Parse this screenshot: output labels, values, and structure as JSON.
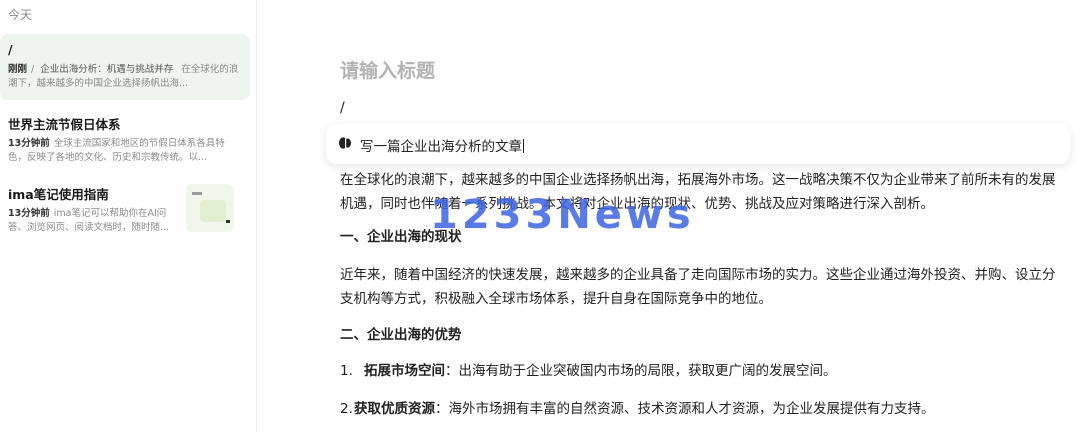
{
  "sidebar": {
    "header": "今天",
    "notes": [
      {
        "title": "/",
        "time": "刚刚",
        "separator": "/",
        "ref_title": "企业出海分析：机遇与挑战并存",
        "snippet": "在全球化的浪潮下，越来越多的中国企业选择扬帆出海..."
      },
      {
        "title": "世界主流节假日体系",
        "time": "13分钟前",
        "snippet": "全球主流国家和地区的节假日体系各具特色，反映了各地的文化、历史和宗教传统。以..."
      },
      {
        "title": "ima笔记使用指南",
        "time": "13分钟前",
        "snippet": "ima笔记可以帮助你在AI问答、浏览网页、阅读文档时，随时随...",
        "thumb_label": "ima"
      }
    ]
  },
  "editor": {
    "title_placeholder": "请输入标题",
    "slash": "/",
    "prompt": {
      "icon": "ai-spark-icon",
      "text": "写一篇企业出海分析的文章"
    },
    "content": {
      "intro": "在全球化的浪潮下，越来越多的中国企业选择扬帆出海，拓展海外市场。这一战略决策不仅为企业带来了前所未有的发展机遇，同时也伴随着一系列挑战。本文将对企业出海的现状、优势、挑战及应对策略进行深入剖析。",
      "h1": "一、企业出海的现状",
      "p1": "近年来，随着中国经济的快速发展，越来越多的企业具备了走向国际市场的实力。这些企业通过海外投资、并购、设立分支机构等方式，积极融入全球市场体系，提升自身在国际竞争中的地位。",
      "h2": "二、企业出海的优势",
      "item1_num": "1.",
      "item1_bold": "拓展市场空间",
      "item1_text": "：出海有助于企业突破国内市场的局限，获取更广阔的发展空间。",
      "item2_num": "2.",
      "item2_bold": "获取优质资源",
      "item2_text": "：海外市场拥有丰富的自然资源、技术资源和人才资源，为企业发展提供有力支持。"
    }
  },
  "watermark": "1233News",
  "colors": {
    "active_note_bg": "#edf5ee",
    "watermark": "#3c64e1",
    "placeholder": "#b3b3b3"
  }
}
